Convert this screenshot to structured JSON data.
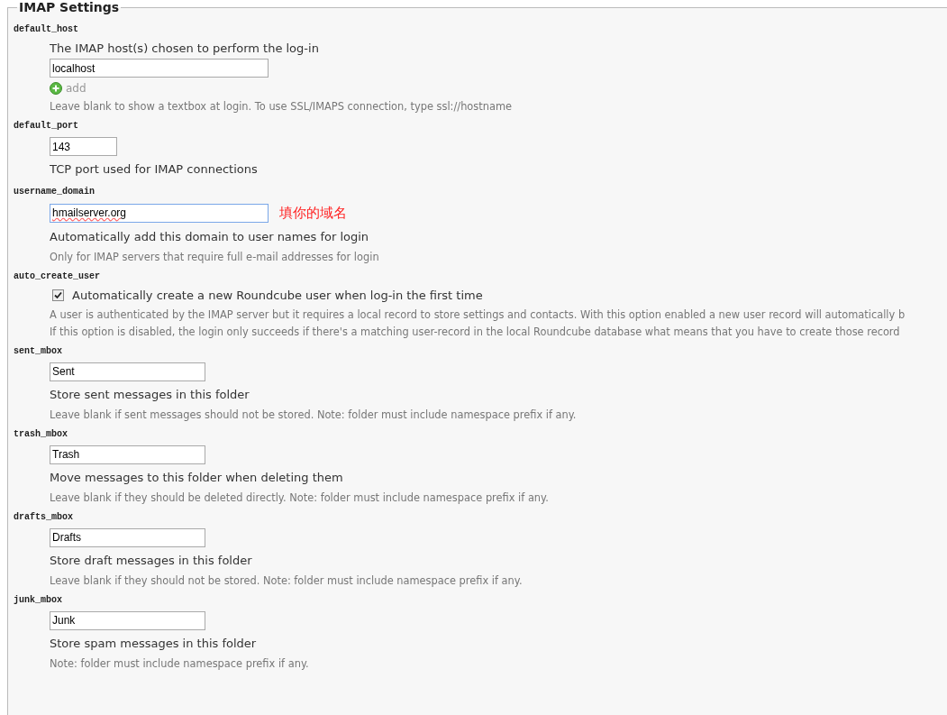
{
  "legend": "IMAP Settings",
  "settings": [
    {
      "kind": "host",
      "name": "default_host",
      "description": "The IMAP host(s) chosen to perform the log-in",
      "value": "localhost",
      "add": "add",
      "hints": [
        "Leave blank to show a textbox at login. To use SSL/IMAPS connection, type ssl://hostname"
      ]
    },
    {
      "kind": "port",
      "name": "default_port",
      "value": "143",
      "description": "TCP port used for IMAP connections"
    },
    {
      "kind": "domain",
      "name": "username_domain",
      "value": "hmailserver.org",
      "focused": true,
      "annotation": "填你的域名",
      "description": "Automatically add this domain to user names for login",
      "hints": [
        "Only for IMAP servers that require full e-mail addresses for login"
      ]
    },
    {
      "kind": "checkbox",
      "name": "auto_create_user",
      "checked": true,
      "description": "Automatically create a new Roundcube user when log-in the first time",
      "hints": [
        "A user is authenticated by the IMAP server but it requires a local record to store settings and contacts. With this option enabled a new user record will automatically b",
        "If this option is disabled, the login only succeeds if there's a matching user-record in the local Roundcube database what means that you have to create those record"
      ]
    },
    {
      "kind": "folder",
      "name": "sent_mbox",
      "value": "Sent",
      "description": "Store sent messages in this folder",
      "hints": [
        "Leave blank if sent messages should not be stored. Note: folder must include namespace prefix if any."
      ]
    },
    {
      "kind": "folder",
      "name": "trash_mbox",
      "value": "Trash",
      "description": "Move messages to this folder when deleting them",
      "hints": [
        "Leave blank if they should be deleted directly. Note: folder must include namespace prefix if any."
      ]
    },
    {
      "kind": "folder",
      "name": "drafts_mbox",
      "value": "Drafts",
      "description": "Store draft messages in this folder",
      "hints": [
        "Leave blank if they should not be stored. Note: folder must include namespace prefix if any."
      ]
    },
    {
      "kind": "folder",
      "name": "junk_mbox",
      "value": "Junk",
      "description": "Store spam messages in this folder",
      "hints": [
        "Note: folder must include namespace prefix if any."
      ]
    }
  ]
}
